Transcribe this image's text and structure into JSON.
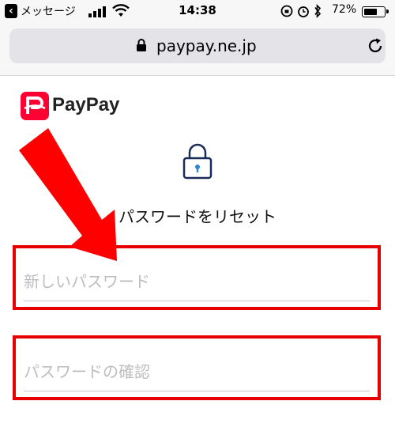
{
  "status_bar": {
    "back_app": "メッセージ",
    "time": "14:38",
    "battery_percent": "72%",
    "battery_level": 0.72
  },
  "browser": {
    "url": "paypay.ne.jp"
  },
  "header": {
    "brand": "PayPay"
  },
  "main": {
    "title": "パスワードをリセット",
    "new_password_placeholder": "新しいパスワード",
    "confirm_password_placeholder": "パスワードの確認"
  },
  "colors": {
    "brand_red": "#ff0033",
    "highlight_red": "#e60000",
    "lock_navy": "#1b2b57",
    "lock_blue": "#2f86d1"
  },
  "icons": [
    "back-icon",
    "signal-icon",
    "wifi-icon",
    "lock-icon",
    "reload-icon",
    "paypay-logo",
    "lock-icon",
    "arrow-annotation"
  ]
}
